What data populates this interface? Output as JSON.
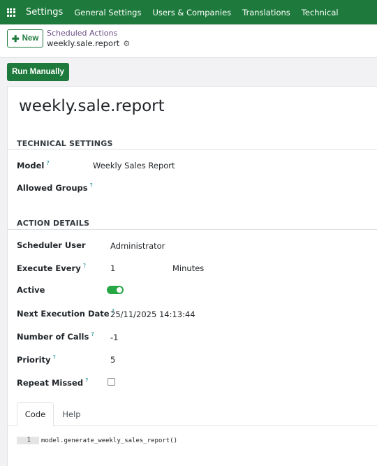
{
  "navbar": {
    "brand": "Settings",
    "menu": [
      "General Settings",
      "Users & Companies",
      "Translations",
      "Technical"
    ],
    "color": "#1e7a3c"
  },
  "control_panel": {
    "new_label": "New",
    "breadcrumb": "Scheduled Actions",
    "record_name": "weekly.sale.report"
  },
  "actions": {
    "run_manually": "Run Manually"
  },
  "form": {
    "title": "weekly.sale.report",
    "technical_settings": {
      "heading": "TECHNICAL SETTINGS",
      "model_label": "Model",
      "model_value": "Weekly Sales Report",
      "allowed_groups_label": "Allowed Groups"
    },
    "action_details": {
      "heading": "ACTION DETAILS",
      "scheduler_user_label": "Scheduler User",
      "scheduler_user_value": "Administrator",
      "execute_every_label": "Execute Every",
      "execute_every_value": "1",
      "execute_every_unit": "Minutes",
      "active_label": "Active",
      "active_value": true,
      "next_execution_label": "Next Execution Date",
      "next_execution_value": "25/11/2025 14:13:44",
      "number_of_calls_label": "Number of Calls",
      "number_of_calls_value": "-1",
      "priority_label": "Priority",
      "priority_value": "5",
      "repeat_missed_label": "Repeat Missed",
      "repeat_missed_value": false
    },
    "help_marker": "?",
    "tabs": {
      "code": "Code",
      "help": "Help"
    },
    "code": {
      "line_number": "1",
      "text": "model.generate_weekly_sales_report()"
    }
  }
}
